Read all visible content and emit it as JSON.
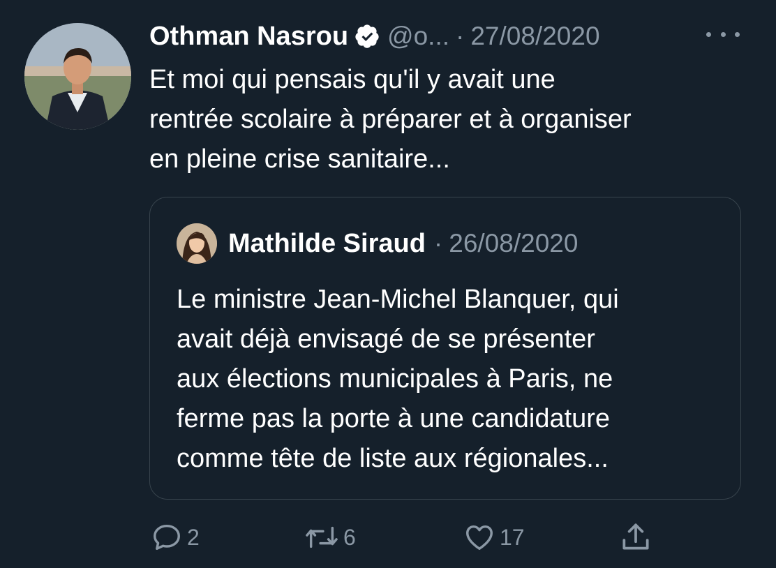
{
  "tweet": {
    "author_name": "Othman Nasrou",
    "author_handle": "@o...",
    "separator": "·",
    "date": "27/08/2020",
    "text_lines": [
      "Et moi qui pensais qu'il y avait une",
      "rentrée scolaire à préparer et à organiser",
      "en pleine crise sanitaire..."
    ]
  },
  "quoted": {
    "author_name": "Mathilde Siraud",
    "separator": "·",
    "date": "26/08/2020",
    "text_lines": [
      "Le ministre Jean-Michel Blanquer, qui",
      "avait déjà envisagé de se présenter",
      "aux élections municipales à Paris, ne",
      "ferme pas la porte à une candidature",
      "comme tête de liste aux régionales..."
    ]
  },
  "actions": {
    "reply_count": "2",
    "retweet_count": "6",
    "like_count": "17"
  },
  "icons": {
    "verified": "verified-badge-icon",
    "more": "more-options-icon",
    "reply": "reply-icon",
    "retweet": "retweet-icon",
    "like": "like-icon",
    "share": "share-icon"
  },
  "colors": {
    "background": "#15202b",
    "text_primary": "#ffffff",
    "text_secondary": "#8b98a5",
    "border": "#38444d"
  }
}
